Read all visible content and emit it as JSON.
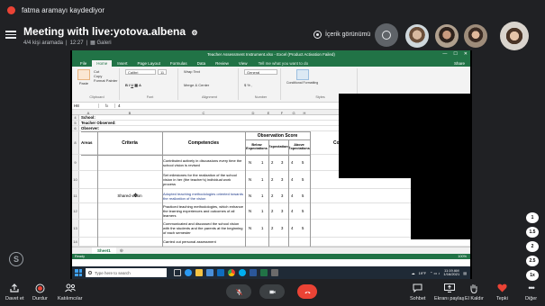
{
  "recording": {
    "text": "fatma aramayı kaydediyor"
  },
  "meeting": {
    "title": "Meeting with live:yotova.albena",
    "participants": "4/4 kişi aramada",
    "duration": "12:27",
    "gallery": "Galeri"
  },
  "content_view": {
    "label": "İçerik görünümü"
  },
  "excel": {
    "window_title": "Teacher Assessment Instrument.xlsx - Excel (Product Activation Failed)",
    "tabs": [
      "File",
      "Home",
      "Insert",
      "Page Layout",
      "Formulas",
      "Data",
      "Review",
      "View"
    ],
    "active_tab": "Home",
    "tell_me": "Tell me what you want to do",
    "share": "Share",
    "ribbon": {
      "clipboard": {
        "cut": "Cut",
        "copy": "Copy",
        "format_painter": "Format Painter",
        "paste": "Paste",
        "label": "Clipboard"
      },
      "font": {
        "name": "Calibri",
        "size": "11",
        "label": "Font"
      },
      "alignment": {
        "wrap": "Wrap Text",
        "merge": "Merge & Center",
        "label": "Alignment"
      },
      "number": {
        "format": "General",
        "label": "Number"
      },
      "styles": {
        "conditional": "Conditional Formatting",
        "format_table": "Format as Table",
        "cell_styles": "Cell Styles",
        "label": "Styles"
      },
      "cells": {
        "insert": "Insert",
        "delete": "Delete",
        "format": "Format",
        "label": "Cells"
      },
      "editing": {
        "autosum": "AutoSum",
        "fill": "Fill",
        "clear": "Clear",
        "sort": "Sort & Filter",
        "find": "Find & Select",
        "label": "Editing"
      }
    },
    "name_box": "H8",
    "formula_value": "4",
    "columns": [
      "A",
      "B",
      "C",
      "D",
      "E",
      "F",
      "G",
      "H"
    ],
    "rows": {
      "r4": {
        "num": "4",
        "text": "School:"
      },
      "r5": {
        "num": "5",
        "text": "Teacher Observed:"
      },
      "r6": {
        "num": "6",
        "text": "Observer:"
      },
      "r8": {
        "num": "8"
      },
      "r9": {
        "num": "9"
      },
      "r10": {
        "num": "10"
      },
      "r11": {
        "num": "11"
      },
      "r12": {
        "num": "12"
      },
      "r13": {
        "num": "13"
      },
      "r14": {
        "num": "14"
      }
    },
    "table_headers": {
      "areas": "Areas",
      "criteria": "Criteria",
      "competencies": "Competencies",
      "observation_score": "Observation Score",
      "below": "Below Expectations",
      "expectations": "Expectations",
      "above": "Above Expectations",
      "comments": "Co"
    },
    "criteria_value": "Shared vision",
    "competency_rows": [
      {
        "text": "Contributed actively in discussions every time the school vision is revised",
        "scores": [
          "N",
          "1",
          "2",
          "3",
          "4",
          "5"
        ]
      },
      {
        "text": "Set milestones for the realization of the school vision in her (the teacher's) individual work process",
        "scores": [
          "N",
          "1",
          "2",
          "3",
          "4",
          "5"
        ]
      },
      {
        "text": "Adopted teaching methodologies oriented towards the realization of the vision",
        "scores": [
          "N",
          "1",
          "2",
          "3",
          "4",
          "5"
        ]
      },
      {
        "text": "Practiced teaching methodologies, which enhance the learning experiences and outcomes of all learners",
        "scores": [
          "N",
          "1",
          "2",
          "3",
          "4",
          "5"
        ]
      },
      {
        "text": "Communicated and discussed the school vision with the students and the parents at the beginning of each semester",
        "scores": [
          "N",
          "1",
          "2",
          "3",
          "4",
          "5"
        ]
      },
      {
        "text": "Carried out personal assessment",
        "scores": []
      }
    ],
    "sheet_tab": "Sheet1",
    "status": "Ready",
    "zoom": "100%"
  },
  "taskbar": {
    "search_placeholder": "Type here to search",
    "temperature": "19°F",
    "time": "11:19 AM",
    "date": "1/16/2021"
  },
  "side_buttons": [
    "1",
    "1.5",
    "2",
    "2.5",
    "1x"
  ],
  "bottom_bar": {
    "leave": "Davet et",
    "stop": "Durdur",
    "participants": "Katılımcılar",
    "chat": "Sohbet",
    "share_screen": "Ekranı paylaş",
    "raise_hand": "El Kaldır",
    "react": "Tepki",
    "more": "Diğer"
  },
  "colors": {
    "excel_green": "#217346",
    "record_red": "#ea4335",
    "background": "#202124"
  }
}
